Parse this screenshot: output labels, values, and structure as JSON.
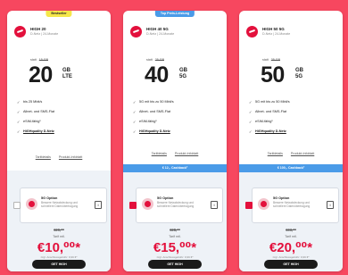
{
  "colors": {
    "page_background": "#f7475f",
    "brand_red": "#e3103c",
    "bestseller_badge": "#f5e74a",
    "highlight_bar": "#4a9be8",
    "cta": "#1a1a1a"
  },
  "cards": [
    {
      "badge": "Bestseller",
      "name": "HIGH 20",
      "subtitle": "D-Netz | 24-Monate",
      "statt_label": "statt",
      "statt_old": "15 GB",
      "gb": "20",
      "gb_unit": "GB",
      "tech": "LTE",
      "features": [
        {
          "text": "bis 25 Mbit/s"
        },
        {
          "text": "Allnet- und SMS-Flat"
        },
        {
          "text": "eSIM-fähig¹"
        },
        {
          "text": "HiGHquality D-Netz"
        }
      ],
      "links": [
        "Tarifdetails",
        "Produkt-Infoblatt"
      ],
      "highlight_bar": "",
      "option": {
        "title": "5G Option",
        "desc": "Bessere Netzabdeckung und schnellere Datenübertragung",
        "checked": false,
        "info": "i"
      },
      "price_old": "€20,⁰⁰",
      "price_label": "Tarif mtl.",
      "price": "€10,⁰⁰*",
      "price_fine": "zzgl. Anschlussgebühr: 9,99 €*",
      "cta": "GET HIGH"
    },
    {
      "badge": "Top Preis-Leistung",
      "name": "HIGH 40 5G",
      "subtitle": "D-Netz | 24-Monate",
      "statt_label": "statt",
      "statt_old": "25 GB",
      "gb": "40",
      "gb_unit": "GB",
      "tech": "5G",
      "features": [
        {
          "text": "5G mit bis zu 50 Mbit/s"
        },
        {
          "text": "Allnet- und SMS-Flat"
        },
        {
          "text": "eSIM-fähig¹"
        },
        {
          "text": "HiGHquality D-Netz"
        }
      ],
      "links": [
        "Tarifdetails",
        "Produkt-Infoblatt"
      ],
      "highlight_bar": "€ 12,- Cashback²",
      "option": {
        "title": "5G Option",
        "desc": "Bessere Netzabdeckung und schnellere Datenübertragung",
        "checked": true,
        "info": "i"
      },
      "price_old": "€28,⁰⁰",
      "price_label": "Tarif mtl.",
      "price": "€15,⁰⁰*",
      "price_fine": "zzgl. Anschlussgebühr: 9,99 €*",
      "cta": "GET HIGH"
    },
    {
      "badge": "",
      "name": "HIGH 50 5G",
      "subtitle": "D-Netz | 24-Monate",
      "statt_label": "statt",
      "statt_old": "35 GB",
      "gb": "50",
      "gb_unit": "GB",
      "tech": "5G",
      "features": [
        {
          "text": "5G mit bis zu 50 Mbit/s"
        },
        {
          "text": "Allnet- und SMS-Flat"
        },
        {
          "text": "eSIM-fähig¹"
        },
        {
          "text": "HiGHquality D-Netz"
        }
      ],
      "links": [
        "Tarifdetails",
        "Produkt-Infoblatt"
      ],
      "highlight_bar": "€ 100,- Cashback²",
      "option": {
        "title": "5G Option",
        "desc": "Bessere Netzabdeckung und schnellere Datenübertragung",
        "checked": true,
        "info": "i"
      },
      "price_old": "€33,⁰⁰",
      "price_label": "Tarif mtl.",
      "price": "€20,⁰⁰*",
      "price_fine": "zzgl. Anschlussgebühr: 9,99 €*",
      "cta": "GET HIGH"
    }
  ]
}
